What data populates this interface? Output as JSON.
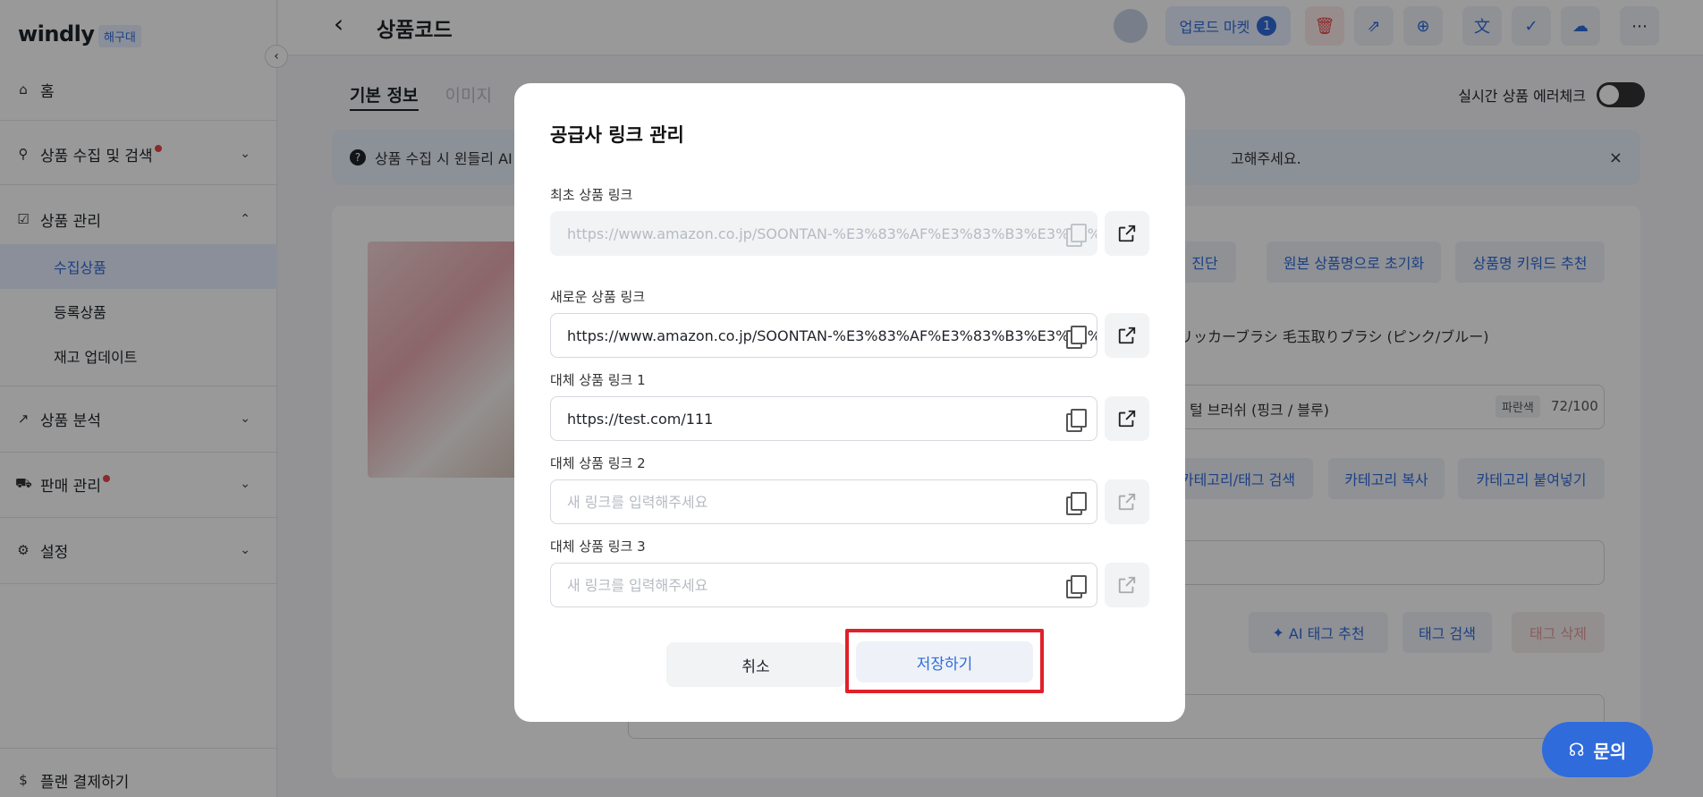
{
  "app": {
    "logo": "windly",
    "badge": "해구대"
  },
  "sidebar": {
    "home": "홈",
    "groups": [
      {
        "label": "상품 수집 및 검색",
        "dot": true
      },
      {
        "label": "상품 관리",
        "dot": false
      },
      {
        "label": "상품 분석",
        "dot": false
      },
      {
        "label": "판매 관리",
        "dot": true
      },
      {
        "label": "설정",
        "dot": false
      }
    ],
    "sub_items": [
      "수집상품",
      "등록상품",
      "재고 업데이트"
    ],
    "plan": "플랜 결제하기"
  },
  "header": {
    "title": "상품코드",
    "upload_market": "업로드 마켓",
    "upload_count": "1"
  },
  "tabs": [
    "기본 정보",
    "이미지"
  ],
  "realtime_check": "실시간 상품 에러체크",
  "notice": {
    "text": "상품 수집 시 윈들리 AI",
    "tail": "고해주세요."
  },
  "background": {
    "diagnose": "진단",
    "reset_name": "원본 상품명으로 초기화",
    "recommend_keyword": "상품명 키워드 추천",
    "jp_title": "リッカーブラシ 毛玉取りブラシ (ピンク/ブルー)",
    "kr_title": "털 브러쉬 (핑크 / 블루)",
    "color_tag": "파란색",
    "char_count": "72/100",
    "category_search": "카테고리/태그 검색",
    "category_copy": "카테고리 복사",
    "category_paste": "카테고리 붙여넣기",
    "ai_tag": "AI 태그 추천",
    "tag_search": "태그 검색",
    "tag_delete": "태그 삭제"
  },
  "inquiry": "문의",
  "modal": {
    "title": "공급사 링크 관리",
    "fields": [
      {
        "label": "최초 상품 링크",
        "value": "https://www.amazon.co.jp/SOONTAN-%E3%83%AF%E3%83%B3%E3%83%8",
        "placeholder": ""
      },
      {
        "label": "새로운 상품 링크",
        "value": "https://www.amazon.co.jp/SOONTAN-%E3%83%AF%E3%83%B3%E3%83%8",
        "placeholder": ""
      },
      {
        "label": "대체 상품 링크 1",
        "value": "https://test.com/111",
        "placeholder": ""
      },
      {
        "label": "대체 상품 링크 2",
        "value": "",
        "placeholder": "새 링크를 입력해주세요"
      },
      {
        "label": "대체 상품 링크 3",
        "value": "",
        "placeholder": "새 링크를 입력해주세요"
      }
    ],
    "cancel": "취소",
    "save": "저장하기"
  }
}
